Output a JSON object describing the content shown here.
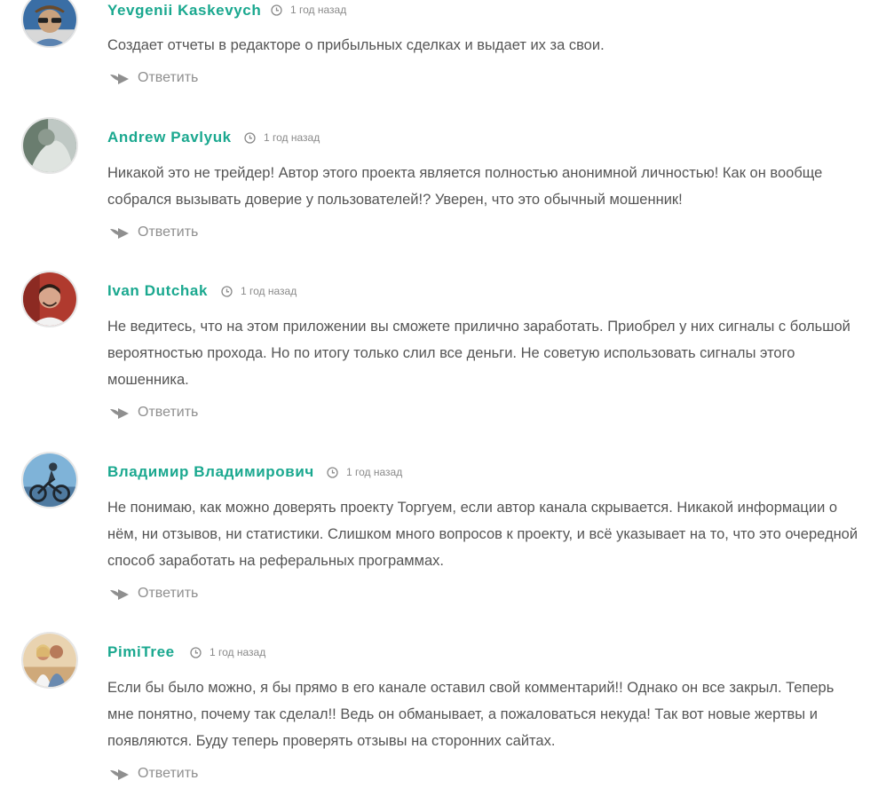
{
  "comments": [
    {
      "author": "Yevgenii Kaskevych",
      "time": "1 год назад",
      "text": "Создает отчеты в редакторе о прибыльных сделках и выдает их за свои.",
      "reply": "Ответить",
      "avatar_icon": "user-photo-sunglasses",
      "avatar_colors": [
        "#c9a27e",
        "#3a6ea5"
      ]
    },
    {
      "author": "Andrew Pavlyuk",
      "time": "1 год назад",
      "text": "Никакой это не трейдер! Автор этого проекта является полностью анонимной личностью! Как он вообще собрался вызывать доверие у пользователей!? Уверен, что это обычный мошенник!",
      "reply": "Ответить",
      "avatar_icon": "user-photo-blurred",
      "avatar_colors": [
        "#bfc8c4",
        "#6a7d6f"
      ]
    },
    {
      "author": "Ivan Dutchak",
      "time": "1 год назад",
      "text": "Не ведитесь, что на этом приложении вы сможете прилично заработать. Приобрел у них сигналы с большой вероятностью прохода. Но по итогу только слил все деньги. Не советую использовать сигналы этого мошенника.",
      "reply": "Ответить",
      "avatar_icon": "user-photo-man",
      "avatar_colors": [
        "#d8a68c",
        "#b03a2e"
      ]
    },
    {
      "author": "Владимир Владимирович",
      "time": "1 год назад",
      "text": "Не понимаю, как можно доверять проекту Торгуем, если автор канала скрывается. Никакой информации о нём, ни отзывов, ни статистики. Слишком много вопросов к проекту, и всё указывает на то, что это очередной способ заработать на реферальных программах.",
      "reply": "Ответить",
      "avatar_icon": "user-photo-cyclist",
      "avatar_colors": [
        "#7fb3d8",
        "#2e3a45"
      ]
    },
    {
      "author": "PimiTree",
      "time": "1 год назад",
      "text": "Если бы было можно, я бы прямо в его канале оставил свой комментарий!! Однако он все закрыл. Теперь мне понятно, почему так сделал!! Ведь он обманывает, а пожаловаться некуда! Так вот новые жертвы и появляются. Буду теперь проверять отзывы на сторонних сайтах.",
      "reply": "Ответить",
      "avatar_icon": "user-photo-couple",
      "avatar_colors": [
        "#e9d3b0",
        "#c98b6b"
      ]
    }
  ],
  "colors": {
    "author": "#1aa88f",
    "text": "#555555",
    "meta": "#8a8a8a",
    "reply": "#8f8f8f"
  }
}
